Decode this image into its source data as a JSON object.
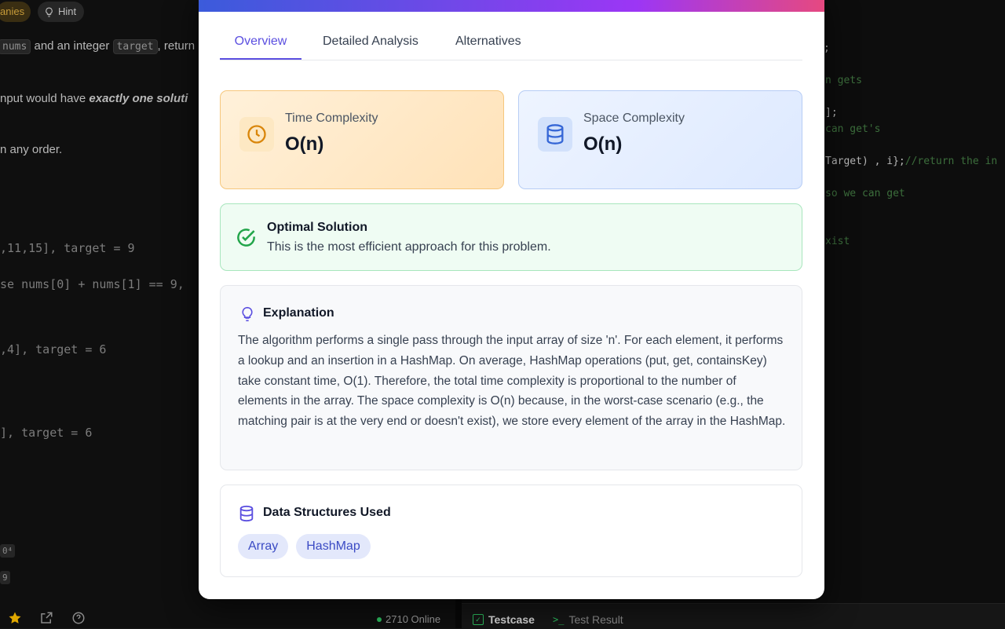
{
  "background": {
    "company_chip": "anies",
    "hint_chip": "Hint",
    "desc_lines": [
      {
        "code": "nums",
        "text": " and an integer "
      },
      {
        "code": "target",
        "text": ", return"
      }
    ],
    "line2_prefix": "nput would have ",
    "line2_emph": "exactly one soluti",
    "line3": "n any order.",
    "example1_input": ",11,15], target = 9",
    "example1_expl": "se nums[0] + nums[1] == 9,",
    "example2_input": ",4], target = 6",
    "example3_input": "], target = 6",
    "constraint_a": "0⁴",
    "constraint_b": "9",
    "online_count": "2710 Online",
    "code_lines": [
      {
        "text": ";",
        "kind": "w"
      },
      {
        "text": "n gets",
        "kind": "g"
      },
      {
        "text": "];",
        "kind": "w"
      },
      {
        "text": "can get's",
        "kind": "g"
      },
      {
        "text": "Target) , i};",
        "kind": "w",
        "tail": "//return the in"
      },
      {
        "text": "so we can get",
        "kind": "g"
      },
      {
        "text": "xist",
        "kind": "g"
      }
    ],
    "testcase_tab": "Testcase",
    "test_result_tab": "Test Result"
  },
  "modal": {
    "tabs": [
      "Overview",
      "Detailed Analysis",
      "Alternatives"
    ],
    "active_tab": "Overview",
    "time": {
      "label": "Time Complexity",
      "value": "O(n)"
    },
    "space": {
      "label": "Space Complexity",
      "value": "O(n)"
    },
    "optimal": {
      "title": "Optimal Solution",
      "desc": "This is the most efficient approach for this problem."
    },
    "explanation": {
      "title": "Explanation",
      "body": "The algorithm performs a single pass through the input array of size 'n'. For each element, it performs a lookup and an insertion in a HashMap. On average, HashMap operations (put, get, containsKey) take constant time, O(1). Therefore, the total time complexity is proportional to the number of elements in the array. The space complexity is O(n) because, in the worst-case scenario (e.g., the matching pair is at the very end or doesn't exist), we store every element of the array in the HashMap."
    },
    "data_structures": {
      "title": "Data Structures Used",
      "items": [
        "Array",
        "HashMap"
      ]
    }
  },
  "colors": {
    "accent": "#5b4fe0",
    "time_icon": "#d9860b",
    "space_icon": "#3566d6",
    "success": "#22a54a",
    "tag_bg": "#e3e8fb"
  },
  "icons": {
    "time": "clock-icon",
    "space": "database-icon",
    "optimal": "check-circle-icon",
    "explanation": "lightbulb-icon",
    "data_structures": "database-icon"
  }
}
